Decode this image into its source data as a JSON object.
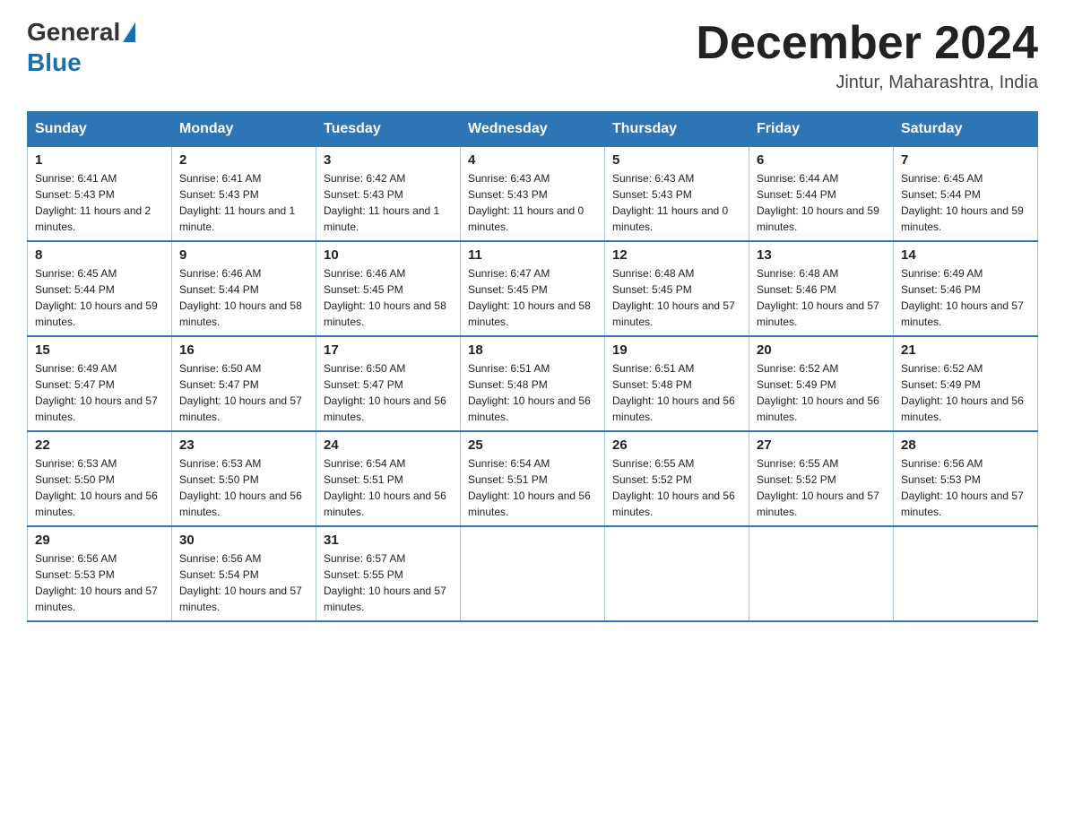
{
  "logo": {
    "general_text": "General",
    "blue_text": "Blue"
  },
  "title": "December 2024",
  "location": "Jintur, Maharashtra, India",
  "days_of_week": [
    "Sunday",
    "Monday",
    "Tuesday",
    "Wednesday",
    "Thursday",
    "Friday",
    "Saturday"
  ],
  "weeks": [
    [
      {
        "day": "1",
        "sunrise": "6:41 AM",
        "sunset": "5:43 PM",
        "daylight": "11 hours and 2 minutes."
      },
      {
        "day": "2",
        "sunrise": "6:41 AM",
        "sunset": "5:43 PM",
        "daylight": "11 hours and 1 minute."
      },
      {
        "day": "3",
        "sunrise": "6:42 AM",
        "sunset": "5:43 PM",
        "daylight": "11 hours and 1 minute."
      },
      {
        "day": "4",
        "sunrise": "6:43 AM",
        "sunset": "5:43 PM",
        "daylight": "11 hours and 0 minutes."
      },
      {
        "day": "5",
        "sunrise": "6:43 AM",
        "sunset": "5:43 PM",
        "daylight": "11 hours and 0 minutes."
      },
      {
        "day": "6",
        "sunrise": "6:44 AM",
        "sunset": "5:44 PM",
        "daylight": "10 hours and 59 minutes."
      },
      {
        "day": "7",
        "sunrise": "6:45 AM",
        "sunset": "5:44 PM",
        "daylight": "10 hours and 59 minutes."
      }
    ],
    [
      {
        "day": "8",
        "sunrise": "6:45 AM",
        "sunset": "5:44 PM",
        "daylight": "10 hours and 59 minutes."
      },
      {
        "day": "9",
        "sunrise": "6:46 AM",
        "sunset": "5:44 PM",
        "daylight": "10 hours and 58 minutes."
      },
      {
        "day": "10",
        "sunrise": "6:46 AM",
        "sunset": "5:45 PM",
        "daylight": "10 hours and 58 minutes."
      },
      {
        "day": "11",
        "sunrise": "6:47 AM",
        "sunset": "5:45 PM",
        "daylight": "10 hours and 58 minutes."
      },
      {
        "day": "12",
        "sunrise": "6:48 AM",
        "sunset": "5:45 PM",
        "daylight": "10 hours and 57 minutes."
      },
      {
        "day": "13",
        "sunrise": "6:48 AM",
        "sunset": "5:46 PM",
        "daylight": "10 hours and 57 minutes."
      },
      {
        "day": "14",
        "sunrise": "6:49 AM",
        "sunset": "5:46 PM",
        "daylight": "10 hours and 57 minutes."
      }
    ],
    [
      {
        "day": "15",
        "sunrise": "6:49 AM",
        "sunset": "5:47 PM",
        "daylight": "10 hours and 57 minutes."
      },
      {
        "day": "16",
        "sunrise": "6:50 AM",
        "sunset": "5:47 PM",
        "daylight": "10 hours and 57 minutes."
      },
      {
        "day": "17",
        "sunrise": "6:50 AM",
        "sunset": "5:47 PM",
        "daylight": "10 hours and 56 minutes."
      },
      {
        "day": "18",
        "sunrise": "6:51 AM",
        "sunset": "5:48 PM",
        "daylight": "10 hours and 56 minutes."
      },
      {
        "day": "19",
        "sunrise": "6:51 AM",
        "sunset": "5:48 PM",
        "daylight": "10 hours and 56 minutes."
      },
      {
        "day": "20",
        "sunrise": "6:52 AM",
        "sunset": "5:49 PM",
        "daylight": "10 hours and 56 minutes."
      },
      {
        "day": "21",
        "sunrise": "6:52 AM",
        "sunset": "5:49 PM",
        "daylight": "10 hours and 56 minutes."
      }
    ],
    [
      {
        "day": "22",
        "sunrise": "6:53 AM",
        "sunset": "5:50 PM",
        "daylight": "10 hours and 56 minutes."
      },
      {
        "day": "23",
        "sunrise": "6:53 AM",
        "sunset": "5:50 PM",
        "daylight": "10 hours and 56 minutes."
      },
      {
        "day": "24",
        "sunrise": "6:54 AM",
        "sunset": "5:51 PM",
        "daylight": "10 hours and 56 minutes."
      },
      {
        "day": "25",
        "sunrise": "6:54 AM",
        "sunset": "5:51 PM",
        "daylight": "10 hours and 56 minutes."
      },
      {
        "day": "26",
        "sunrise": "6:55 AM",
        "sunset": "5:52 PM",
        "daylight": "10 hours and 56 minutes."
      },
      {
        "day": "27",
        "sunrise": "6:55 AM",
        "sunset": "5:52 PM",
        "daylight": "10 hours and 57 minutes."
      },
      {
        "day": "28",
        "sunrise": "6:56 AM",
        "sunset": "5:53 PM",
        "daylight": "10 hours and 57 minutes."
      }
    ],
    [
      {
        "day": "29",
        "sunrise": "6:56 AM",
        "sunset": "5:53 PM",
        "daylight": "10 hours and 57 minutes."
      },
      {
        "day": "30",
        "sunrise": "6:56 AM",
        "sunset": "5:54 PM",
        "daylight": "10 hours and 57 minutes."
      },
      {
        "day": "31",
        "sunrise": "6:57 AM",
        "sunset": "5:55 PM",
        "daylight": "10 hours and 57 minutes."
      },
      null,
      null,
      null,
      null
    ]
  ]
}
